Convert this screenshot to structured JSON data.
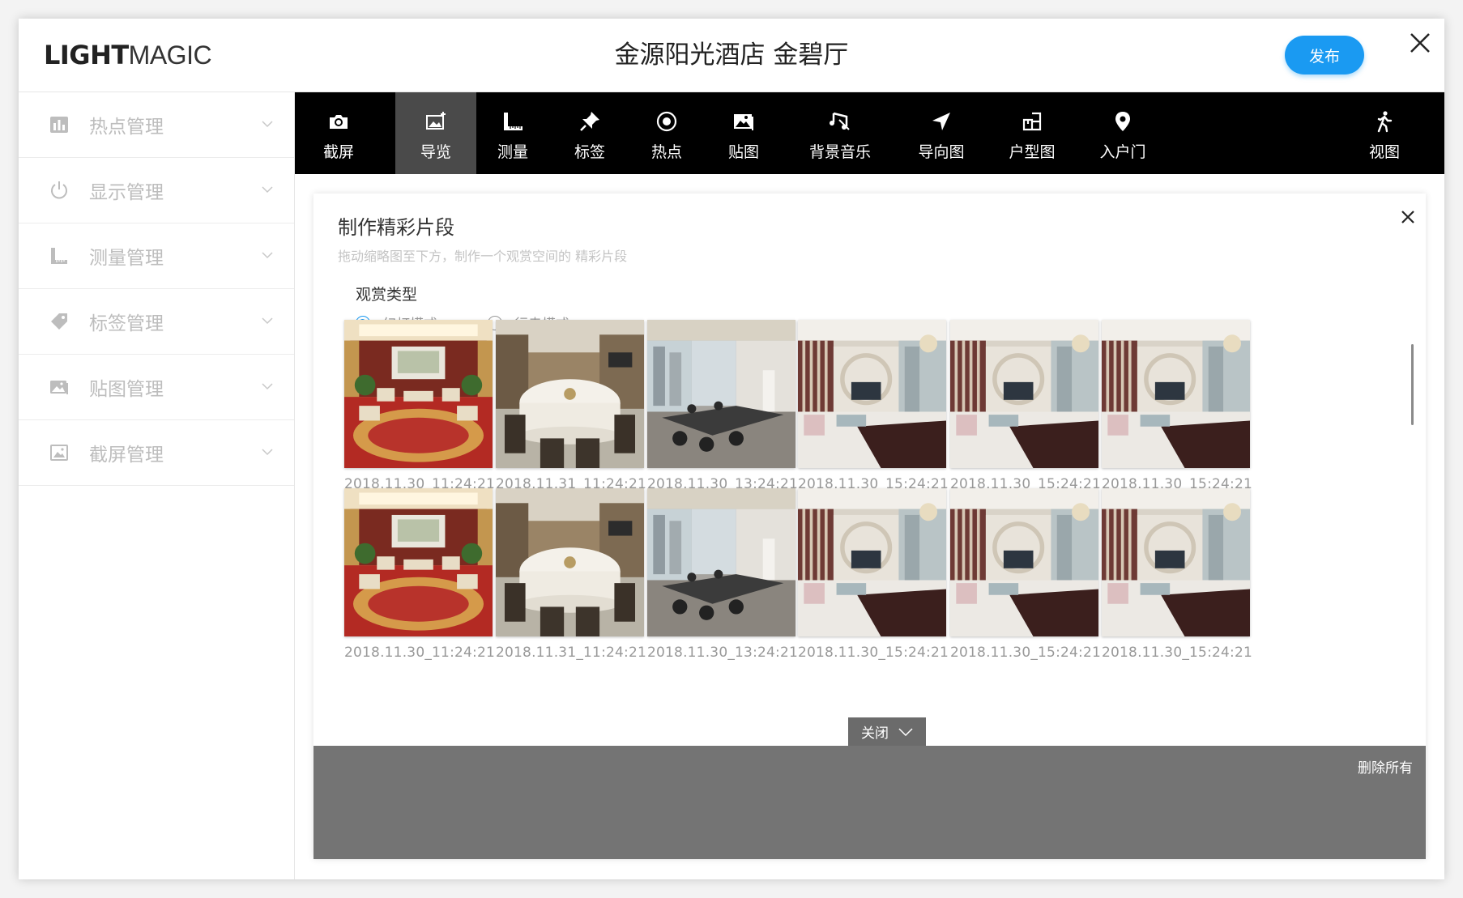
{
  "header": {
    "logo_bold": "LIGHT",
    "logo_light": "MAGIC",
    "title": "金源阳光酒店 金碧厅",
    "publish_label": "发布"
  },
  "sidebar": {
    "items": [
      {
        "label": "热点管理",
        "icon": "bar-chart-icon"
      },
      {
        "label": "显示管理",
        "icon": "power-icon"
      },
      {
        "label": "测量管理",
        "icon": "ruler-icon"
      },
      {
        "label": "标签管理",
        "icon": "tag-icon"
      },
      {
        "label": "贴图管理",
        "icon": "image-icon"
      },
      {
        "label": "截屏管理",
        "icon": "picture-icon"
      }
    ]
  },
  "toolbar": {
    "items": [
      {
        "label": "截屏",
        "icon": "camera-icon"
      },
      {
        "label": "导览",
        "icon": "image-add-icon",
        "active": true
      },
      {
        "label": "测量",
        "icon": "ruler-icon"
      },
      {
        "label": "标签",
        "icon": "pin-icon"
      },
      {
        "label": "热点",
        "icon": "target-icon"
      },
      {
        "label": "贴图",
        "icon": "photo-icon"
      },
      {
        "label": "背景音乐",
        "icon": "music-icon"
      },
      {
        "label": "导向图",
        "icon": "navigation-icon"
      },
      {
        "label": "户型图",
        "icon": "floorplan-icon"
      },
      {
        "label": "入户门",
        "icon": "location-pin-icon"
      },
      {
        "label": "视图",
        "icon": "walking-person-icon"
      }
    ]
  },
  "panel": {
    "title": "制作精彩片段",
    "subtitle": "拖动缩略图至下方，制作一个观赏空间的 精彩片段",
    "view_type_label": "观赏类型",
    "modes": [
      {
        "label": "幻灯模式",
        "selected": true
      },
      {
        "label": "行走模式",
        "selected": false
      }
    ],
    "thumbnails": [
      {
        "caption": "2018.11.30_11:24:21",
        "scene": "hall-red"
      },
      {
        "caption": "2018.11.31_11:24:21",
        "scene": "dining-round"
      },
      {
        "caption": "2018.11.30_13:24:21",
        "scene": "dining-window"
      },
      {
        "caption": "2018.11.30_15:24:21",
        "scene": "living"
      },
      {
        "caption": "2018.11.30_15:24:21",
        "scene": "living"
      },
      {
        "caption": "2018.11.30_15:24:21",
        "scene": "living"
      },
      {
        "caption": "2018.11.30_11:24:21",
        "scene": "hall-red"
      },
      {
        "caption": "2018.11.31_11:24:21",
        "scene": "dining-round"
      },
      {
        "caption": "2018.11.30_13:24:21",
        "scene": "dining-window"
      },
      {
        "caption": "2018.11.30_15:24:21",
        "scene": "living"
      },
      {
        "caption": "2018.11.30_15:24:21",
        "scene": "living"
      },
      {
        "caption": "2018.11.30_15:24:21",
        "scene": "living"
      }
    ],
    "close_label": "关闭",
    "delete_all_label": "删除所有"
  },
  "colors": {
    "accent": "#1a9af2",
    "toolbar_bg": "#000000",
    "toolbar_active": "#4a4a4a",
    "dropzone": "#747474"
  }
}
